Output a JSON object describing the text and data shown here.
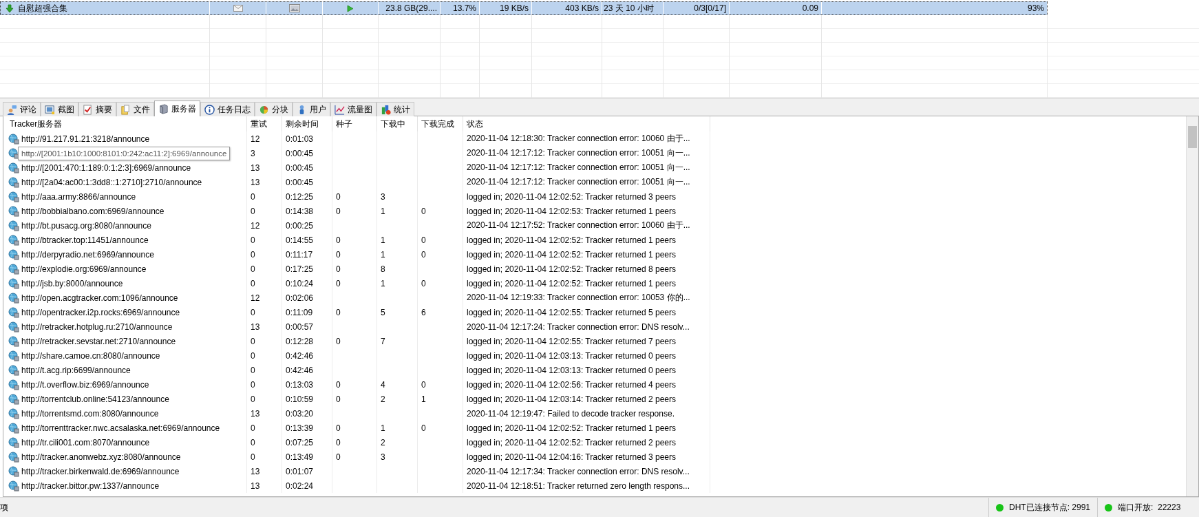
{
  "task_list": {
    "rows": [
      {
        "name": "自慰超强合集",
        "selected": true,
        "size": "23.8 GB(29....",
        "percent": "13.7%",
        "download_speed": "19 KB/s",
        "upload_speed": "403 KB/s",
        "remaining": "23 天 10 小时",
        "peers": "0/3[0/17]",
        "ratio": "0.09",
        "progress": "93%"
      }
    ]
  },
  "tabs": [
    {
      "label": "评论",
      "selected": false
    },
    {
      "label": "截图",
      "selected": false
    },
    {
      "label": "摘要",
      "selected": false
    },
    {
      "label": "文件",
      "selected": false
    },
    {
      "label": "服务器",
      "selected": true
    },
    {
      "label": "任务日志",
      "selected": false
    },
    {
      "label": "分块",
      "selected": false
    },
    {
      "label": "用户",
      "selected": false
    },
    {
      "label": "流量图",
      "selected": false
    },
    {
      "label": "统计",
      "selected": false
    }
  ],
  "tracker_table": {
    "columns": [
      "Tracker服务器",
      "重试",
      "剩余时间",
      "种子",
      "下载中",
      "下载完成",
      "状态"
    ],
    "tooltip": "http://[2001:1b10:1000:8101:0:242:ac11:2]:6969/announce",
    "rows": [
      {
        "url": "http://91.217.91.21:3218/announce",
        "retry": "12",
        "remaining": "0:01:03",
        "status": "2020-11-04 12:18:30: Tracker connection error: 10060 由于..."
      },
      {
        "retry": "3",
        "remaining": "0:00:45",
        "status": "2020-11-04 12:17:12: Tracker connection error: 10051 向一..."
      },
      {
        "url": "http://[2001:470:1:189:0:1:2:3]:6969/announce",
        "retry": "13",
        "remaining": "0:00:45",
        "status": "2020-11-04 12:17:12: Tracker connection error: 10051 向一..."
      },
      {
        "url": "http://[2a04:ac00:1:3dd8::1:2710]:2710/announce",
        "retry": "13",
        "remaining": "0:00:45",
        "status": "2020-11-04 12:17:12: Tracker connection error: 10051 向一..."
      },
      {
        "url": "http://aaa.army:8866/announce",
        "retry": "0",
        "remaining": "0:12:25",
        "seeds": "0",
        "downloading": "3",
        "status": "logged in; 2020-11-04 12:02:52: Tracker returned 3 peers"
      },
      {
        "url": "http://bobbialbano.com:6969/announce",
        "retry": "0",
        "remaining": "0:14:38",
        "seeds": "0",
        "downloading": "1",
        "completed": "0",
        "status": "logged in; 2020-11-04 12:02:53: Tracker returned 1 peers"
      },
      {
        "url": "http://bt.pusacg.org:8080/announce",
        "retry": "12",
        "remaining": "0:00:25",
        "status": "2020-11-04 12:17:52: Tracker connection error: 10060 由于..."
      },
      {
        "url": "http://btracker.top:11451/announce",
        "retry": "0",
        "remaining": "0:14:55",
        "seeds": "0",
        "downloading": "1",
        "completed": "0",
        "status": "logged in; 2020-11-04 12:02:52: Tracker returned 1 peers"
      },
      {
        "url": "http://derpyradio.net:6969/announce",
        "retry": "0",
        "remaining": "0:11:17",
        "seeds": "0",
        "downloading": "1",
        "completed": "0",
        "status": "logged in; 2020-11-04 12:02:52: Tracker returned 1 peers"
      },
      {
        "url": "http://explodie.org:6969/announce",
        "retry": "0",
        "remaining": "0:17:25",
        "seeds": "0",
        "downloading": "8",
        "status": "logged in; 2020-11-04 12:02:52: Tracker returned 8 peers"
      },
      {
        "url": "http://jsb.by:8000/announce",
        "retry": "0",
        "remaining": "0:10:24",
        "seeds": "0",
        "downloading": "1",
        "completed": "0",
        "status": "logged in; 2020-11-04 12:02:52: Tracker returned 1 peers"
      },
      {
        "url": "http://open.acgtracker.com:1096/announce",
        "retry": "12",
        "remaining": "0:02:06",
        "status": "2020-11-04 12:19:33: Tracker connection error: 10053 你的..."
      },
      {
        "url": "http://opentracker.i2p.rocks:6969/announce",
        "retry": "0",
        "remaining": "0:11:09",
        "seeds": "0",
        "downloading": "5",
        "completed": "6",
        "status": "logged in; 2020-11-04 12:02:55: Tracker returned 5 peers"
      },
      {
        "url": "http://retracker.hotplug.ru:2710/announce",
        "retry": "13",
        "remaining": "0:00:57",
        "status": "2020-11-04 12:17:24: Tracker connection error: DNS resolv..."
      },
      {
        "url": "http://retracker.sevstar.net:2710/announce",
        "retry": "0",
        "remaining": "0:12:28",
        "seeds": "0",
        "downloading": "7",
        "status": "logged in; 2020-11-04 12:02:55: Tracker returned 7 peers"
      },
      {
        "url": "http://share.camoe.cn:8080/announce",
        "retry": "0",
        "remaining": "0:42:46",
        "status": "logged in; 2020-11-04 12:03:13: Tracker returned 0 peers"
      },
      {
        "url": "http://t.acg.rip:6699/announce",
        "retry": "0",
        "remaining": "0:42:46",
        "status": "logged in; 2020-11-04 12:03:13: Tracker returned 0 peers"
      },
      {
        "url": "http://t.overflow.biz:6969/announce",
        "retry": "0",
        "remaining": "0:13:03",
        "seeds": "0",
        "downloading": "4",
        "completed": "0",
        "status": "logged in; 2020-11-04 12:02:56: Tracker returned 4 peers"
      },
      {
        "url": "http://torrentclub.online:54123/announce",
        "retry": "0",
        "remaining": "0:10:59",
        "seeds": "0",
        "downloading": "2",
        "completed": "1",
        "status": "logged in; 2020-11-04 12:03:14: Tracker returned 2 peers"
      },
      {
        "url": "http://torrentsmd.com:8080/announce",
        "retry": "13",
        "remaining": "0:03:20",
        "status": "2020-11-04 12:19:47: Failed to decode tracker response."
      },
      {
        "url": "http://torrenttracker.nwc.acsalaska.net:6969/announce",
        "retry": "0",
        "remaining": "0:13:39",
        "seeds": "0",
        "downloading": "1",
        "completed": "0",
        "status": "logged in; 2020-11-04 12:02:52: Tracker returned 1 peers"
      },
      {
        "url": "http://tr.cili001.com:8070/announce",
        "retry": "0",
        "remaining": "0:07:25",
        "seeds": "0",
        "downloading": "2",
        "status": "logged in; 2020-11-04 12:02:52: Tracker returned 2 peers"
      },
      {
        "url": "http://tracker.anonwebz.xyz:8080/announce",
        "retry": "0",
        "remaining": "0:13:49",
        "seeds": "0",
        "downloading": "3",
        "status": "logged in; 2020-11-04 12:04:16: Tracker returned 3 peers"
      },
      {
        "url": "http://tracker.birkenwald.de:6969/announce",
        "retry": "13",
        "remaining": "0:01:07",
        "status": "2020-11-04 12:17:34: Tracker connection error: DNS resolv..."
      },
      {
        "url": "http://tracker.bittor.pw:1337/announce",
        "retry": "13",
        "remaining": "0:02:24",
        "status": "2020-11-04 12:18:51: Tracker returned zero length respons..."
      }
    ]
  },
  "status_bar": {
    "left_text": "项",
    "indicators": [
      {
        "label": "DHT已连接节点: 2991",
        "connected": true
      },
      {
        "label": "端口开放:  22223",
        "connected": true
      }
    ]
  }
}
